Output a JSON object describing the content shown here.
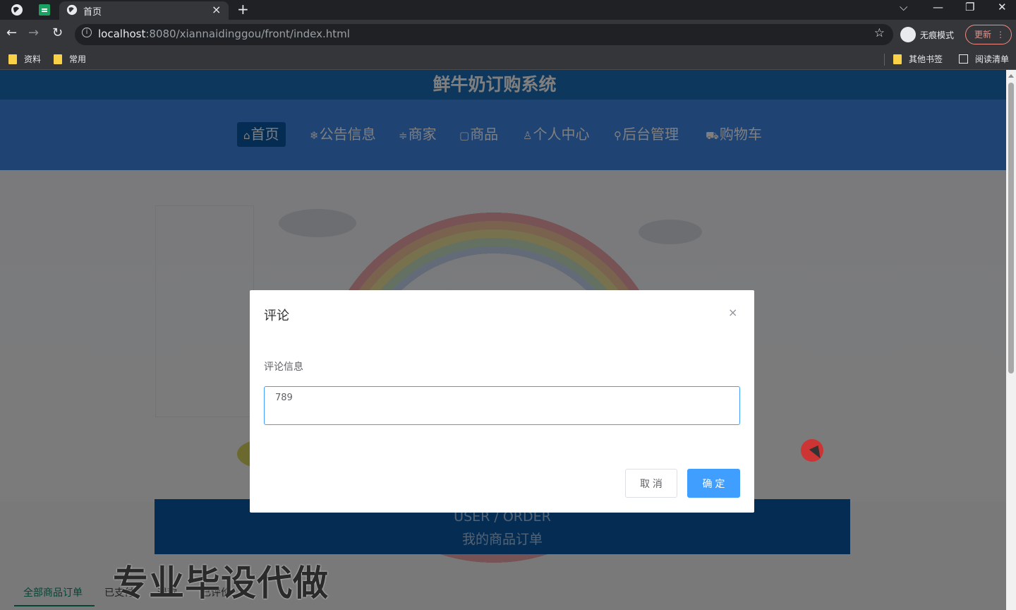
{
  "browser": {
    "tab_title": "首页",
    "tab_close": "×",
    "new_tab": "+",
    "url_host": "localhost",
    "url_path": ":8080/xiannaidinggou/front/index.html",
    "incognito_label": "无痕模式",
    "update_label": "更新",
    "bookmarks": [
      "资料",
      "常用"
    ],
    "other_bookmarks": "其他书签",
    "reading_list": "阅读清单"
  },
  "site": {
    "title": "鲜牛奶订购系统",
    "nav": [
      {
        "glyph": "⌂",
        "label": "首页"
      },
      {
        "glyph": "❄",
        "label": "公告信息"
      },
      {
        "glyph": "≑",
        "label": "商家"
      },
      {
        "glyph": "▢",
        "label": "商品"
      },
      {
        "glyph": "♙",
        "label": "个人中心"
      },
      {
        "glyph": "⚲",
        "label": "后台管理"
      },
      {
        "glyph": "⛟",
        "label": "购物车"
      }
    ]
  },
  "order_section": {
    "title_en": "USER / ORDER",
    "title_zh": "我的商品订单",
    "tabs": [
      "全部商品订单",
      "已支付",
      "退款",
      "已评价"
    ]
  },
  "dialog": {
    "title": "评论",
    "close": "×",
    "field_label": "评论信息",
    "comment_value": "789",
    "cancel_label": "取 消",
    "confirm_label": "确 定"
  },
  "watermark": "专业毕设代做",
  "colors": {
    "header_blue": "#1a6eba",
    "nav_blue": "#3e86e6",
    "active_blue": "#0b5aa8",
    "primary_button": "#409eff"
  }
}
